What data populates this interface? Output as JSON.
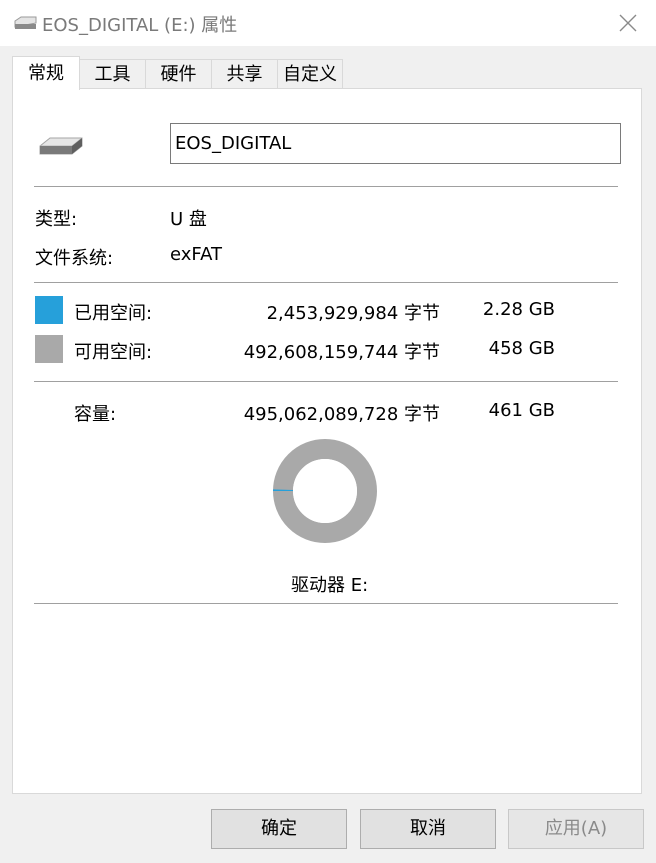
{
  "window": {
    "title": "EOS_DIGITAL (E:) 属性",
    "close_glyph": "✕"
  },
  "tabs": [
    {
      "label": "常规",
      "active": true
    },
    {
      "label": "工具"
    },
    {
      "label": "硬件"
    },
    {
      "label": "共享"
    },
    {
      "label": "自定义"
    }
  ],
  "general": {
    "drive_name": "EOS_DIGITAL",
    "type_label": "类型:",
    "type_value": "U 盘",
    "fs_label": "文件系统:",
    "fs_value": "exFAT",
    "used": {
      "label": "已用空间:",
      "bytes": "2,453,929,984 字节",
      "size": "2.28 GB",
      "color": "#26a0da"
    },
    "free": {
      "label": "可用空间:",
      "bytes": "492,608,159,744 字节",
      "size": "458 GB",
      "color": "#a9a9a9"
    },
    "capacity": {
      "label": "容量:",
      "bytes": "495,062,089,728 字节",
      "size": "461 GB"
    },
    "usage_fraction": 0.005,
    "drive_label": "驱动器 E:"
  },
  "buttons": {
    "ok": "确定",
    "cancel": "取消",
    "apply": "应用(A)"
  },
  "icons": {
    "title": "drive-icon",
    "drive": "usb-drive-icon",
    "close": "close-icon"
  }
}
